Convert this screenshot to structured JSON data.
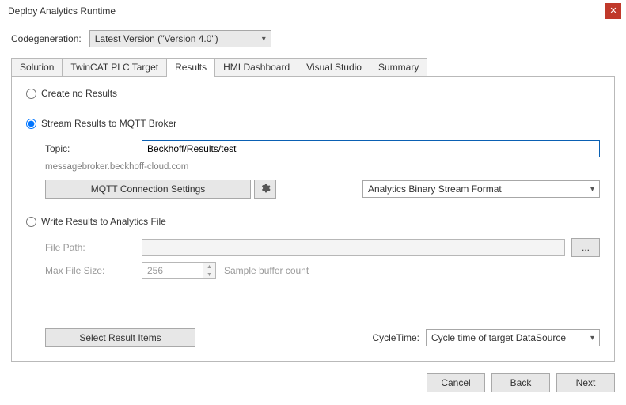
{
  "window": {
    "title": "Deploy Analytics Runtime"
  },
  "codegen": {
    "label": "Codegeneration:",
    "value": "Latest Version (\"Version 4.0\")"
  },
  "tabs": [
    {
      "label": "Solution"
    },
    {
      "label": "TwinCAT PLC Target"
    },
    {
      "label": "Results"
    },
    {
      "label": "HMI Dashboard"
    },
    {
      "label": "Visual Studio"
    },
    {
      "label": "Summary"
    }
  ],
  "results": {
    "option_none": "Create no Results",
    "option_stream": "Stream Results to MQTT Broker",
    "option_file": "Write Results to Analytics File",
    "topic_label": "Topic:",
    "topic_value": "Beckhoff/Results/test",
    "broker_host": "messagebroker.beckhoff-cloud.com",
    "mqtt_settings_btn": "MQTT Connection Settings",
    "format_combo": "Analytics Binary Stream Format",
    "file_path_label": "File Path:",
    "file_path_value": "",
    "browse_btn": "...",
    "max_file_size_label": "Max File Size:",
    "max_file_size_value": "256",
    "max_file_size_hint": "Sample buffer count",
    "select_items_btn": "Select Result Items",
    "cycletime_label": "CycleTime:",
    "cycletime_value": "Cycle time of target DataSource"
  },
  "footer": {
    "cancel": "Cancel",
    "back": "Back",
    "next": "Next"
  }
}
